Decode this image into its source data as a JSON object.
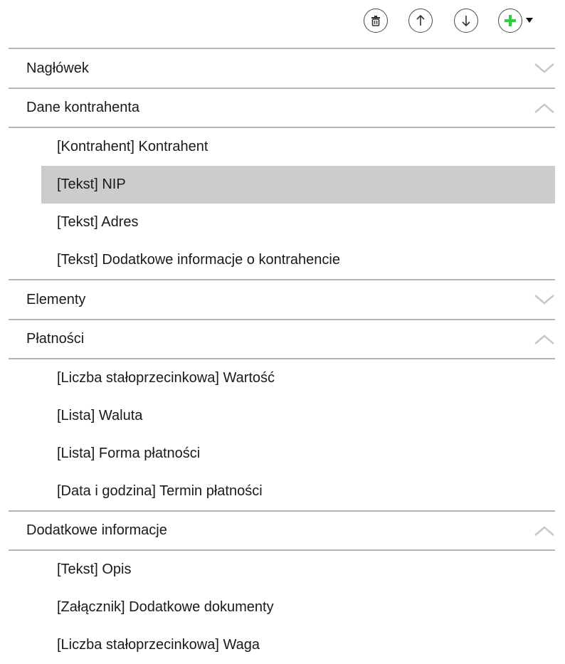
{
  "toolbar": {
    "delete_icon": "trash-icon",
    "up_icon": "arrow-up-icon",
    "down_icon": "arrow-down-icon",
    "add_icon": "plus-icon",
    "accent_add": "#2ecc40"
  },
  "sections": [
    {
      "label": "Nagłówek",
      "expanded": false,
      "items": []
    },
    {
      "label": "Dane kontrahenta",
      "expanded": true,
      "items": [
        {
          "label": "[Kontrahent] Kontrahent",
          "selected": false
        },
        {
          "label": "[Tekst] NIP",
          "selected": true
        },
        {
          "label": "[Tekst] Adres",
          "selected": false
        },
        {
          "label": "[Tekst] Dodatkowe informacje o kontrahencie",
          "selected": false
        }
      ]
    },
    {
      "label": "Elementy",
      "expanded": false,
      "items": []
    },
    {
      "label": "Płatności",
      "expanded": true,
      "items": [
        {
          "label": "[Liczba stałoprzecinkowa] Wartość",
          "selected": false
        },
        {
          "label": "[Lista] Waluta",
          "selected": false
        },
        {
          "label": "[Lista] Forma płatności",
          "selected": false
        },
        {
          "label": "[Data i godzina] Termin płatności",
          "selected": false
        }
      ]
    },
    {
      "label": "Dodatkowe informacje",
      "expanded": true,
      "items": [
        {
          "label": "[Tekst] Opis",
          "selected": false
        },
        {
          "label": "[Załącznik] Dodatkowe dokumenty",
          "selected": false
        },
        {
          "label": "[Liczba stałoprzecinkowa] Waga",
          "selected": false
        }
      ]
    }
  ],
  "colors": {
    "selected_bg": "#cccccc",
    "divider": "#b3b3b3",
    "chevron": "#c8c8c8"
  }
}
